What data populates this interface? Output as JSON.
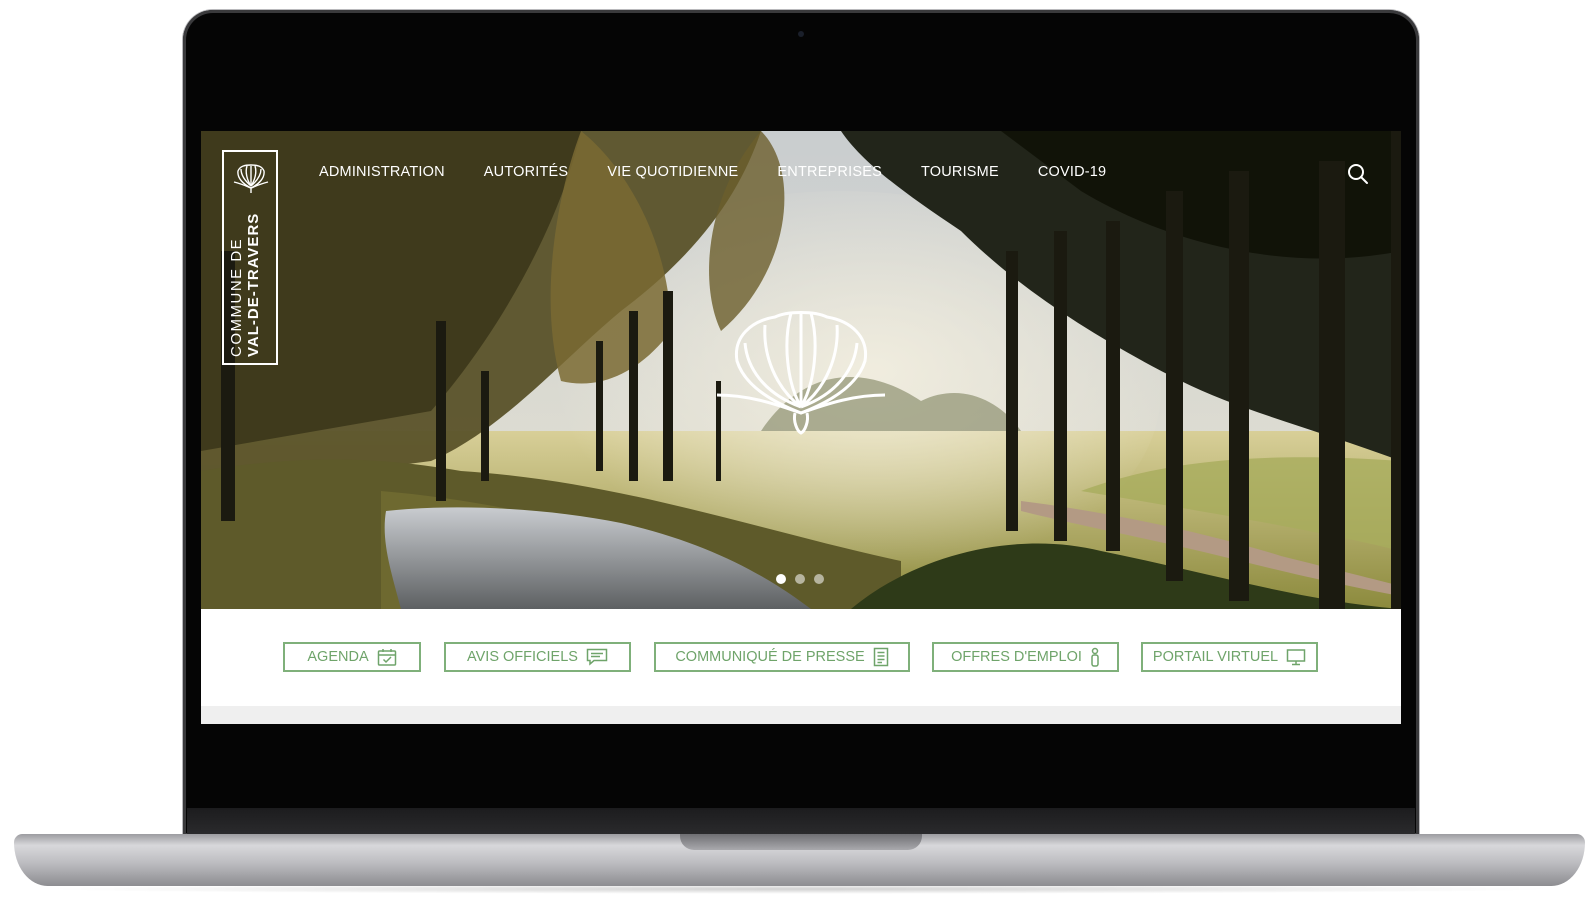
{
  "site": {
    "logo": {
      "line1": "COMMUNE DE",
      "line2": "VAL-DE-TRAVERS",
      "icon": "shell-flower-icon"
    },
    "nav": [
      {
        "label": "ADMINISTRATION"
      },
      {
        "label": "AUTORITÉS"
      },
      {
        "label": "VIE QUOTIDIENNE"
      },
      {
        "label": "ENTREPRISES"
      },
      {
        "label": "TOURISME"
      },
      {
        "label": "COVID-19"
      }
    ],
    "search_icon": "search-icon",
    "hero": {
      "slide_count": 3,
      "active_slide": 1,
      "emblem": "shell-flower-icon"
    },
    "quicklinks": [
      {
        "label": "AGENDA",
        "icon": "calendar-check-icon"
      },
      {
        "label": "AVIS OFFICIELS",
        "icon": "chat-bubble-icon"
      },
      {
        "label": "COMMUNIQUÉ DE PRESSE",
        "icon": "document-icon"
      },
      {
        "label": "OFFRES D'EMPLOI",
        "icon": "person-icon"
      },
      {
        "label": "PORTAIL VIRTUEL",
        "icon": "monitor-icon"
      }
    ],
    "colors": {
      "accent_green": "#6fa46a",
      "nav_text": "#ffffff"
    }
  }
}
